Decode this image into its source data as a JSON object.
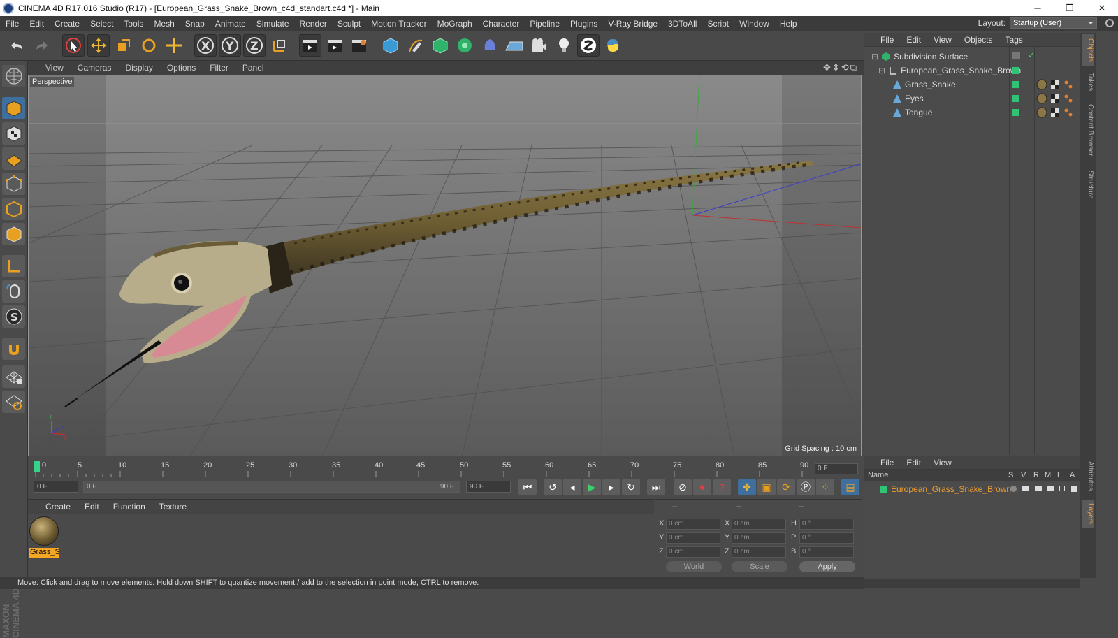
{
  "window": {
    "title": "CINEMA 4D R17.016 Studio (R17) - [European_Grass_Snake_Brown_c4d_standart.c4d *] - Main",
    "minimize": "─",
    "restore": "❐",
    "close": "✕"
  },
  "menu": {
    "items": [
      "File",
      "Edit",
      "Create",
      "Select",
      "Tools",
      "Mesh",
      "Snap",
      "Animate",
      "Simulate",
      "Render",
      "Sculpt",
      "Motion Tracker",
      "MoGraph",
      "Character",
      "Pipeline",
      "Plugins",
      "V-Ray Bridge",
      "3DToAll",
      "Script",
      "Window",
      "Help"
    ],
    "layout_label": "Layout:",
    "layout_value": "Startup (User)"
  },
  "toolbar": {
    "axis_x": "X",
    "axis_y": "Y",
    "axis_z": "Z"
  },
  "viewport": {
    "menu": [
      "View",
      "Cameras",
      "Display",
      "Options",
      "Filter",
      "Panel"
    ],
    "nav": "✥⇕⟲⧉",
    "camera_label": "Perspective",
    "grid_spacing": "Grid Spacing : 10 cm"
  },
  "timeline": {
    "ticks": [
      "0",
      "5",
      "10",
      "15",
      "20",
      "25",
      "30",
      "35",
      "40",
      "45",
      "50",
      "55",
      "60",
      "65",
      "70",
      "75",
      "80",
      "85",
      "90"
    ],
    "current_frame": "0 F"
  },
  "playback": {
    "start_field": "0 F",
    "range_start": "0 F",
    "range_end": "90 F",
    "end_field": "90 F"
  },
  "material": {
    "menu": [
      "Create",
      "Edit",
      "Function",
      "Texture"
    ],
    "items": [
      {
        "name": "Grass_Sn"
      }
    ]
  },
  "coords": {
    "header_1": "--",
    "header_2": "--",
    "header_3": "--",
    "rows": [
      {
        "a": "X",
        "av": "0 cm",
        "b": "X",
        "bv": "0 cm",
        "c": "H",
        "cv": "0 °"
      },
      {
        "a": "Y",
        "av": "0 cm",
        "b": "Y",
        "bv": "0 cm",
        "c": "P",
        "cv": "0 °"
      },
      {
        "a": "Z",
        "av": "0 cm",
        "b": "Z",
        "bv": "0 cm",
        "c": "B",
        "cv": "0 °"
      }
    ],
    "world": "World",
    "scale": "Scale",
    "apply": "Apply"
  },
  "objects": {
    "menu": [
      "File",
      "Edit",
      "View",
      "Objects",
      "Tags"
    ],
    "tree": [
      {
        "name": "Subdivision Surface",
        "indent": 0
      },
      {
        "name": "European_Grass_Snake_Brown",
        "indent": 1
      },
      {
        "name": "Grass_Snake",
        "indent": 2
      },
      {
        "name": "Eyes",
        "indent": 2
      },
      {
        "name": "Tongue",
        "indent": 2
      }
    ]
  },
  "layers": {
    "menu": [
      "File",
      "Edit",
      "View"
    ],
    "col_name": "Name",
    "cols": [
      "S",
      "V",
      "R",
      "M",
      "L",
      "A"
    ],
    "rows": [
      {
        "name": "European_Grass_Snake_Brown"
      }
    ]
  },
  "sidetabs": [
    "Objects",
    "Takes",
    "Content Browser",
    "Structure",
    "Attributes",
    "Layers"
  ],
  "status": "Move: Click and drag to move elements. Hold down SHIFT to quantize movement / add to the selection in point mode, CTRL to remove.",
  "brand": "MAXON CINEMA 4D"
}
